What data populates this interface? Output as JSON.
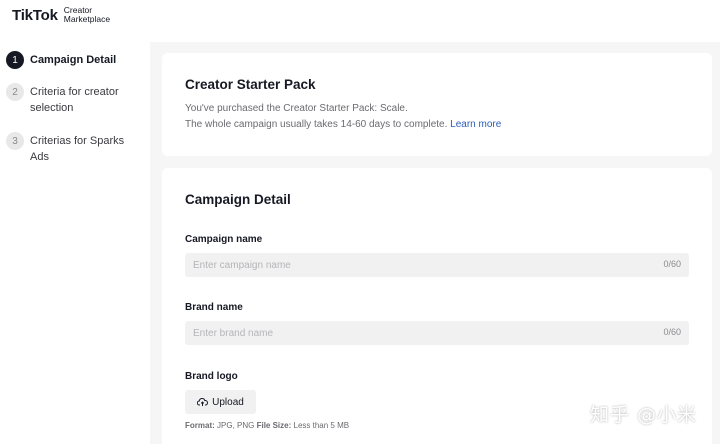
{
  "header": {
    "logo_main": "TikTok",
    "logo_sub_line1": "Creator",
    "logo_sub_line2": "Marketplace"
  },
  "sidebar": {
    "steps": [
      {
        "number": "1",
        "label": "Campaign Detail",
        "active": true
      },
      {
        "number": "2",
        "label": "Criteria for creator selection",
        "active": false
      },
      {
        "number": "3",
        "label": "Criterias for Sparks Ads",
        "active": false
      }
    ]
  },
  "starter_pack": {
    "title": "Creator Starter Pack",
    "line1": "You've purchased the Creator Starter Pack: Scale.",
    "line2": "The whole campaign usually takes 14-60 days to complete.",
    "learn_more": "Learn more"
  },
  "campaign_detail": {
    "title": "Campaign Detail",
    "campaign_name": {
      "label": "Campaign name",
      "placeholder": "Enter campaign name",
      "value": "",
      "counter": "0/60"
    },
    "brand_name": {
      "label": "Brand name",
      "placeholder": "Enter brand name",
      "value": "",
      "counter": "0/60"
    },
    "brand_logo": {
      "label": "Brand logo",
      "upload_label": "Upload",
      "format_label": "Format:",
      "format_value": "JPG, PNG",
      "size_label": "File Size:",
      "size_value": "Less than 5 MB"
    }
  },
  "watermark": "知乎 @小米",
  "colors": {
    "accent_link": "#2b5db8",
    "active_step": "#161823",
    "page_bg": "#f6f6f6"
  },
  "icons": {
    "upload": "cloud-upload-icon"
  }
}
